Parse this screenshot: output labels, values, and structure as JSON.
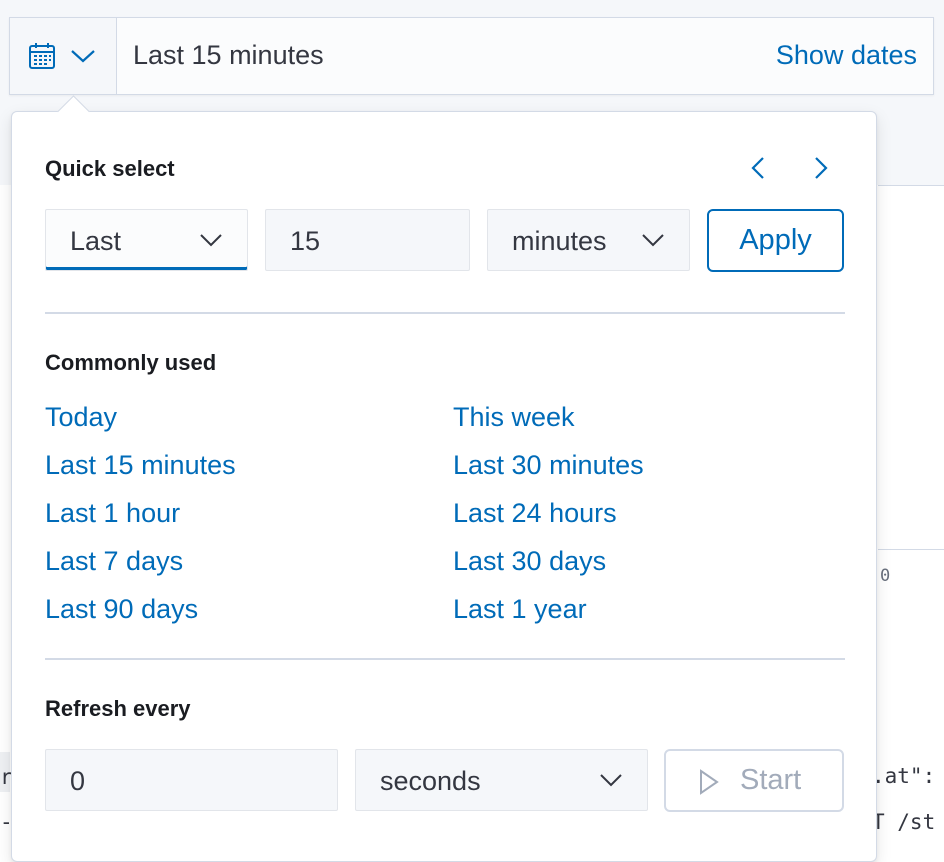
{
  "topbar": {
    "calendar_icon": "calendar-icon",
    "chevron_icon": "chevron-down-icon",
    "range_text": "Last 15 minutes",
    "show_dates_label": "Show dates"
  },
  "quick_select": {
    "title": "Quick select",
    "prev_icon": "chevron-left-icon",
    "next_icon": "chevron-right-icon",
    "direction_value": "Last",
    "amount_value": "15",
    "unit_value": "minutes",
    "apply_label": "Apply"
  },
  "commonly_used": {
    "title": "Commonly used",
    "left": [
      "Today",
      "Last 15 minutes",
      "Last 1 hour",
      "Last 7 days",
      "Last 90 days"
    ],
    "right": [
      "This week",
      "Last 30 minutes",
      "Last 24 hours",
      "Last 30 days",
      "Last 1 year"
    ]
  },
  "refresh": {
    "title": "Refresh every",
    "interval_value": "0",
    "unit_value": "seconds",
    "start_label": "Start",
    "play_icon": "play-icon"
  },
  "background": {
    "zero": "0",
    "code_line_1": ".at\":",
    "code_line_2": "T /st",
    "left_code_1": "r",
    "left_code_2": "-"
  },
  "colors": {
    "accent": "#006bb8",
    "text": "#1a1c21",
    "border": "#d3dae6",
    "field_bg": "#f5f7fa",
    "disabled": "#a2abba"
  }
}
